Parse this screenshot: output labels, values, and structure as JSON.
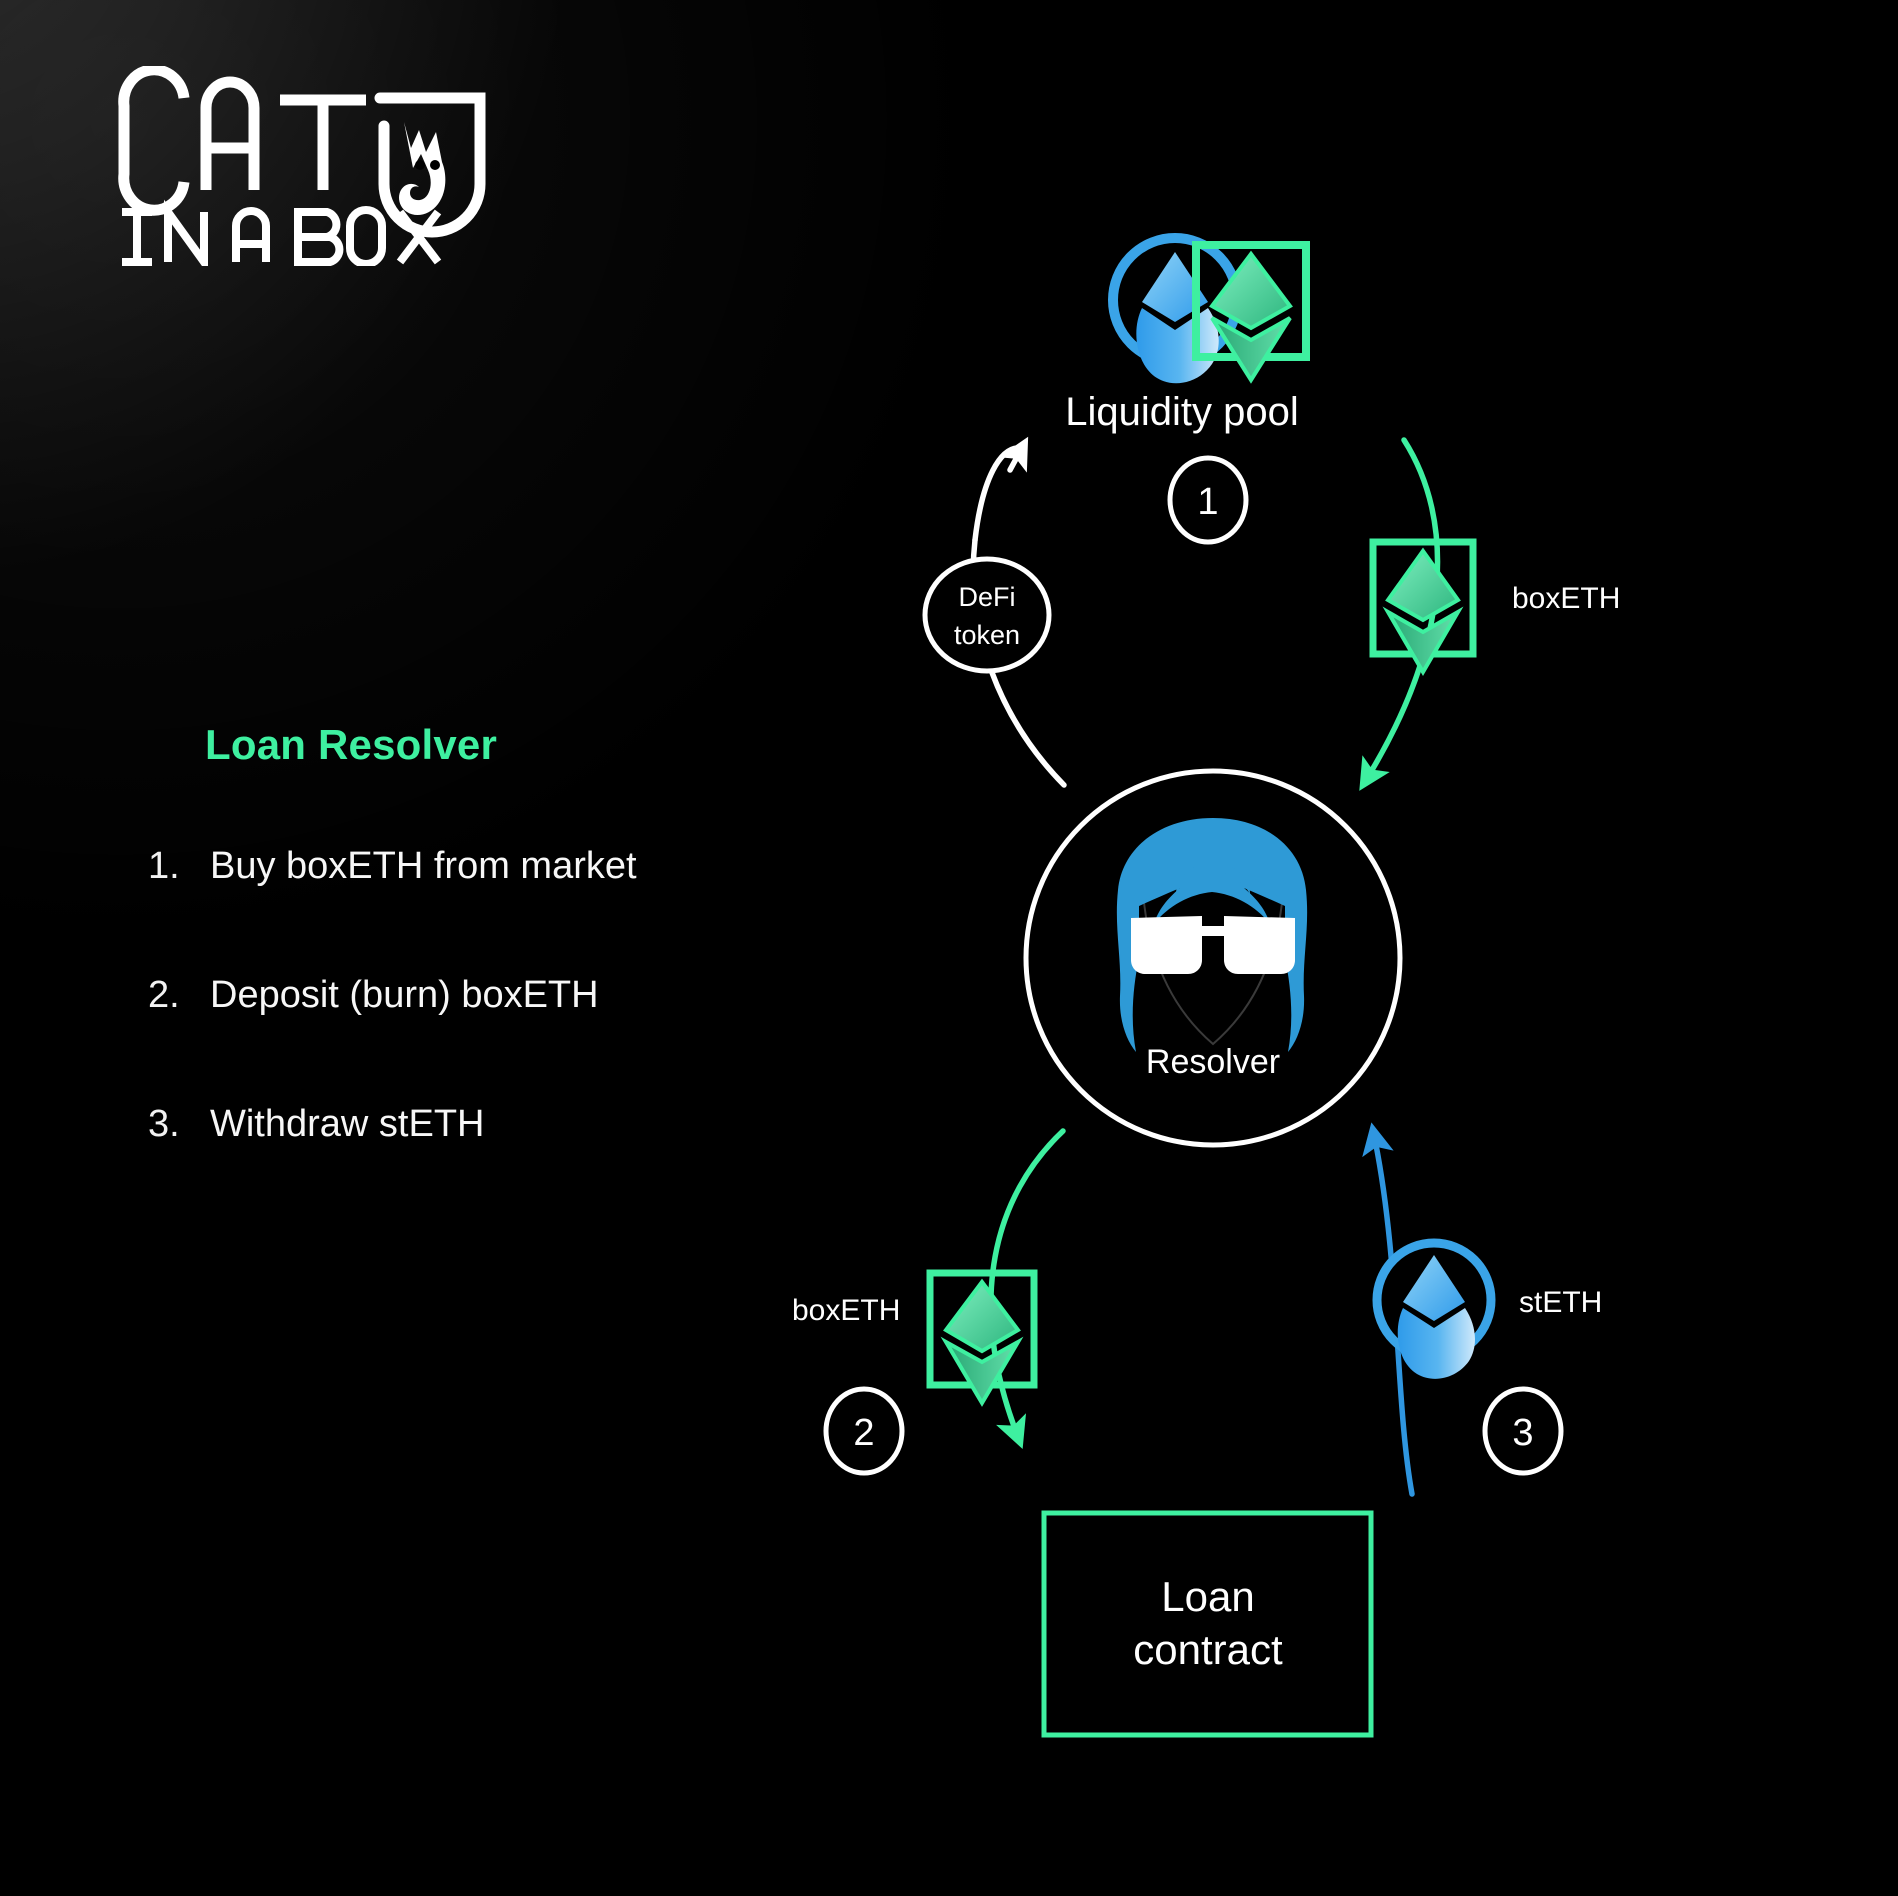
{
  "brand": {
    "logo_line1": "CAT",
    "logo_line2": "IN A BOX",
    "logo_icon": "cat-in-box-icon"
  },
  "colors": {
    "background": "#000000",
    "accent_green": "#3ef0a0",
    "accent_blue": "#3aa4e8",
    "text_primary": "#ffffff",
    "stroke_white": "#ffffff"
  },
  "panel": {
    "title": "Loan Resolver",
    "steps": [
      {
        "number": "1.",
        "text": "Buy boxETH from market"
      },
      {
        "number": "2.",
        "text": "Deposit (burn) boxETH"
      },
      {
        "number": "3.",
        "text": "Withdraw stETH"
      }
    ]
  },
  "diagram": {
    "nodes": {
      "liquidity_pool": {
        "label": "Liquidity pool",
        "icons": [
          "steth-circle-icon",
          "boxeth-square-icon"
        ]
      },
      "resolver": {
        "label": "Resolver",
        "icon": "resolver-avatar-icon"
      },
      "loan_contract": {
        "label_line1": "Loan",
        "label_line2": "contract"
      }
    },
    "badges": [
      {
        "id": "step-1",
        "text": "1"
      },
      {
        "id": "step-2",
        "text": "2"
      },
      {
        "id": "step-3",
        "text": "3"
      }
    ],
    "edge_labels": {
      "defi_token": {
        "line1": "DeFi",
        "line2": "token"
      },
      "boxeth_top": "boxETH",
      "boxeth_bottom": "boxETH",
      "steth_bottom": "stETH"
    }
  }
}
